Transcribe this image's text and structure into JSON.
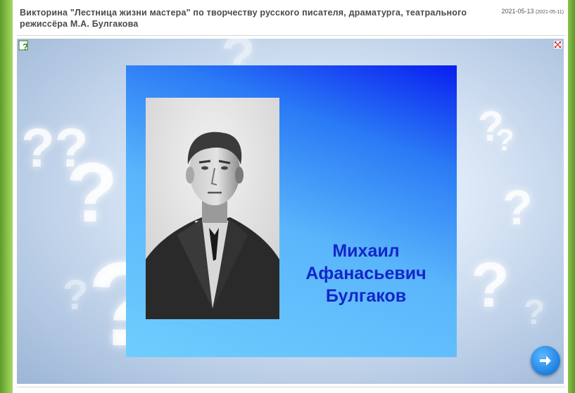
{
  "header": {
    "title": "Викторина \"Лестница жизни мастера\" по творчеству русского писателя, драматурга, театрального режиссёра М.А. Булгакова",
    "date": "2021-05-13",
    "date_original": "(2021-05-11)"
  },
  "slide": {
    "name_line1": "Михаил",
    "name_line2": "Афанасьевич",
    "name_line3": "Булгаков"
  },
  "controls": {
    "help_icon": "help-question-icon",
    "fullscreen_icon": "fullscreen-close-icon",
    "next_icon": "arrow-right-icon"
  },
  "colors": {
    "slide_gradient_top": "#0a1ef0",
    "slide_gradient_bottom": "#6fcdfd",
    "name_text": "#1525c9",
    "next_button": "#1e7fe0"
  }
}
